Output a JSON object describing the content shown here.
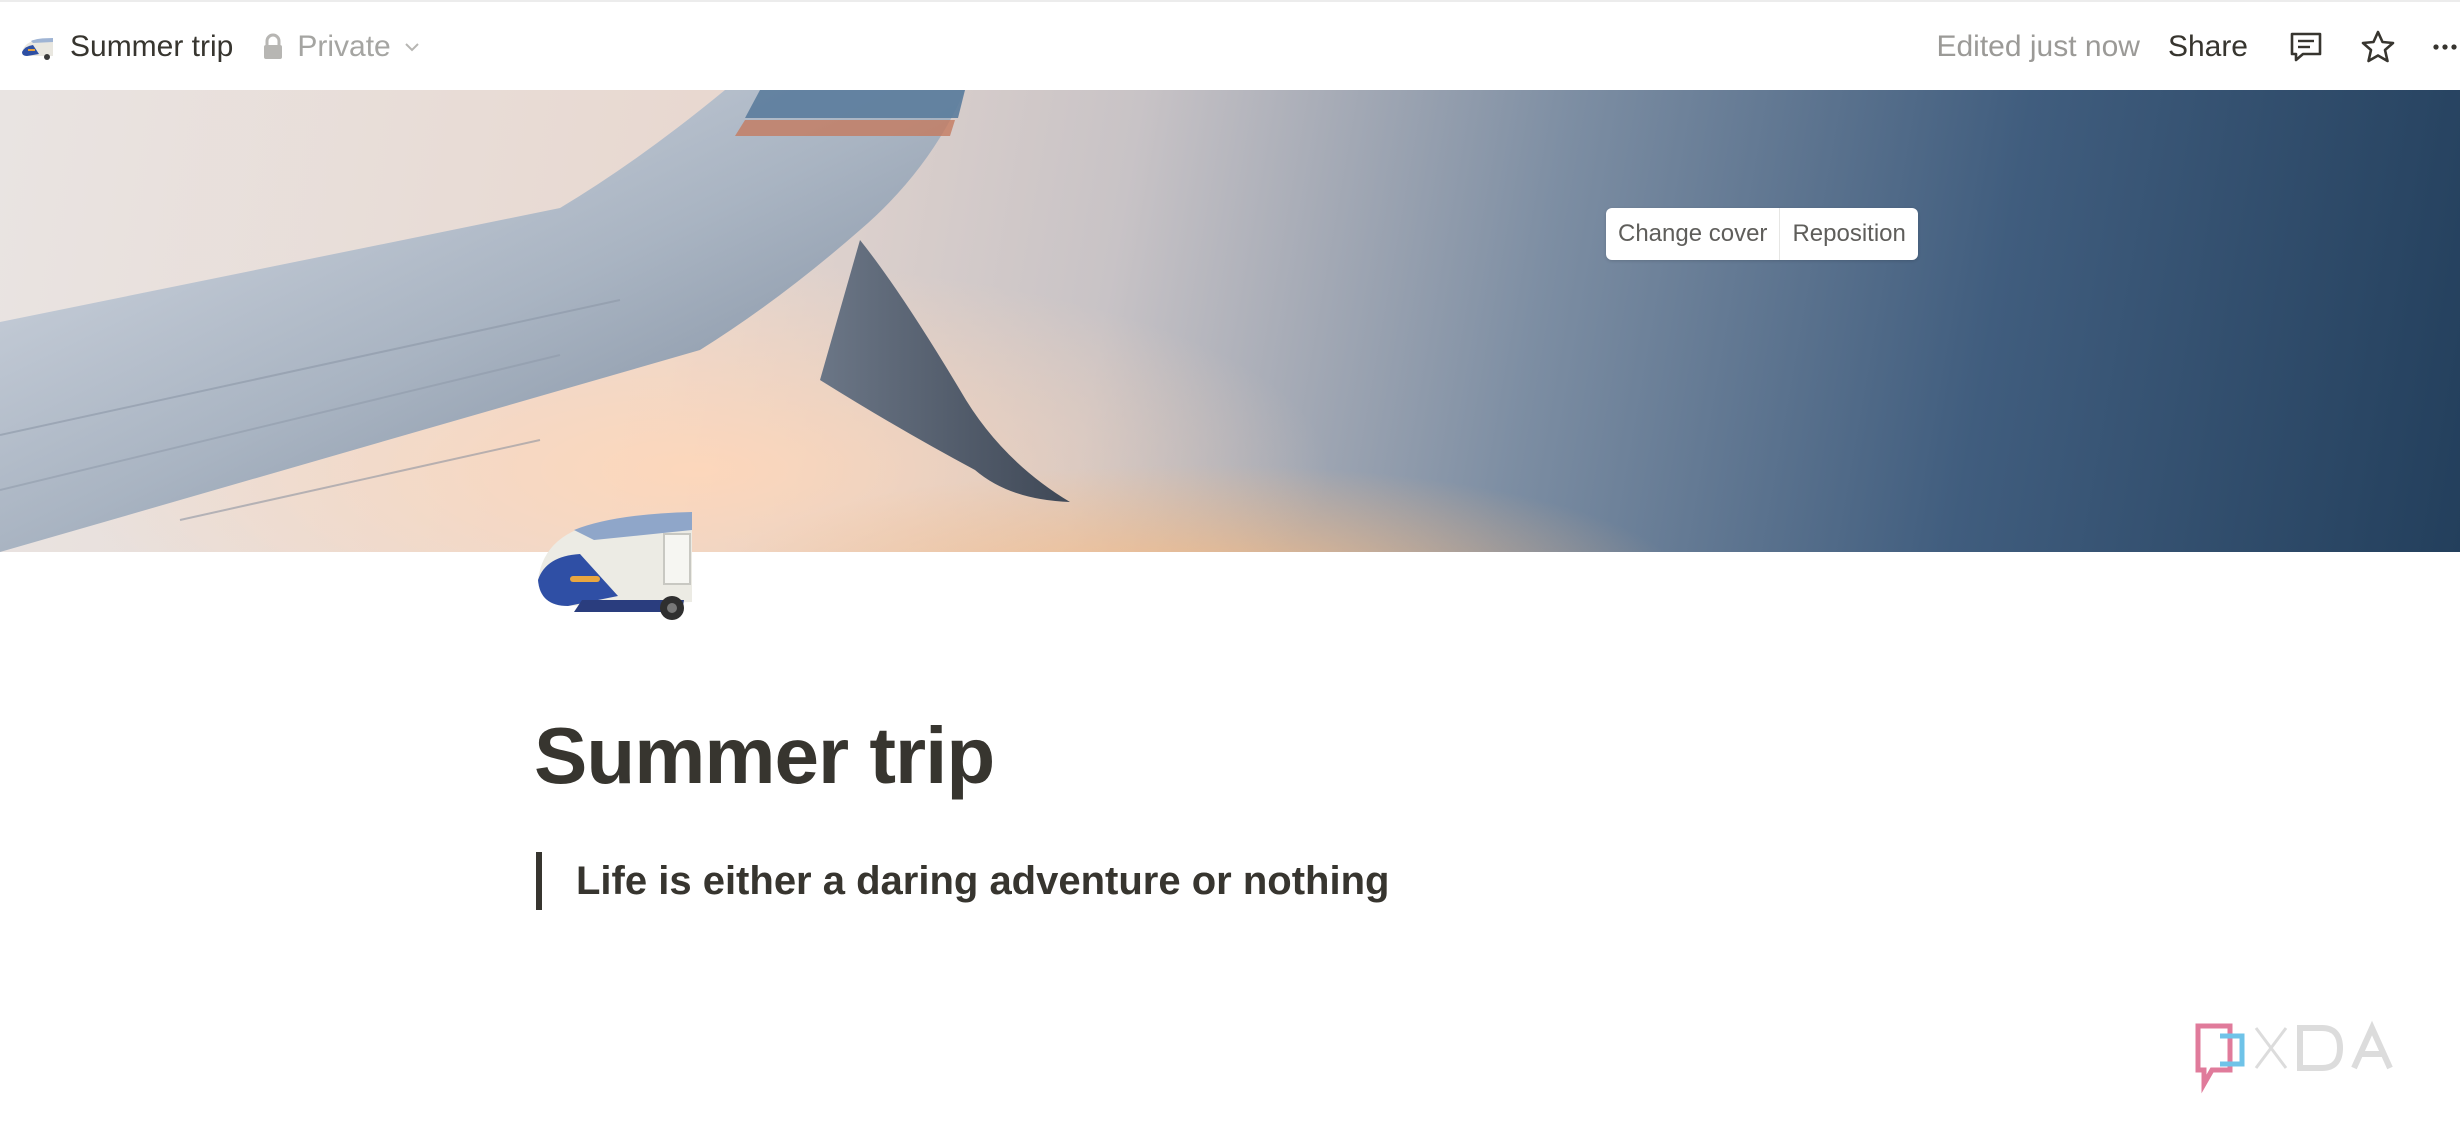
{
  "topbar": {
    "page_title": "Summer trip",
    "privacy_label": "Private",
    "edited_status": "Edited just now",
    "share_label": "Share"
  },
  "cover": {
    "change_cover_label": "Change cover",
    "reposition_label": "Reposition"
  },
  "page": {
    "title": "Summer trip",
    "quote": "Life is either a daring adventure or nothing",
    "icon": "high-speed-train-emoji"
  },
  "watermark": {
    "text": "XDA"
  },
  "colors": {
    "text": "#37352f",
    "muted": "#9b9a97",
    "background": "#ffffff"
  },
  "icons": [
    "train-icon",
    "lock-icon",
    "chevron-down-icon",
    "comment-icon",
    "star-icon",
    "more-icon"
  ]
}
